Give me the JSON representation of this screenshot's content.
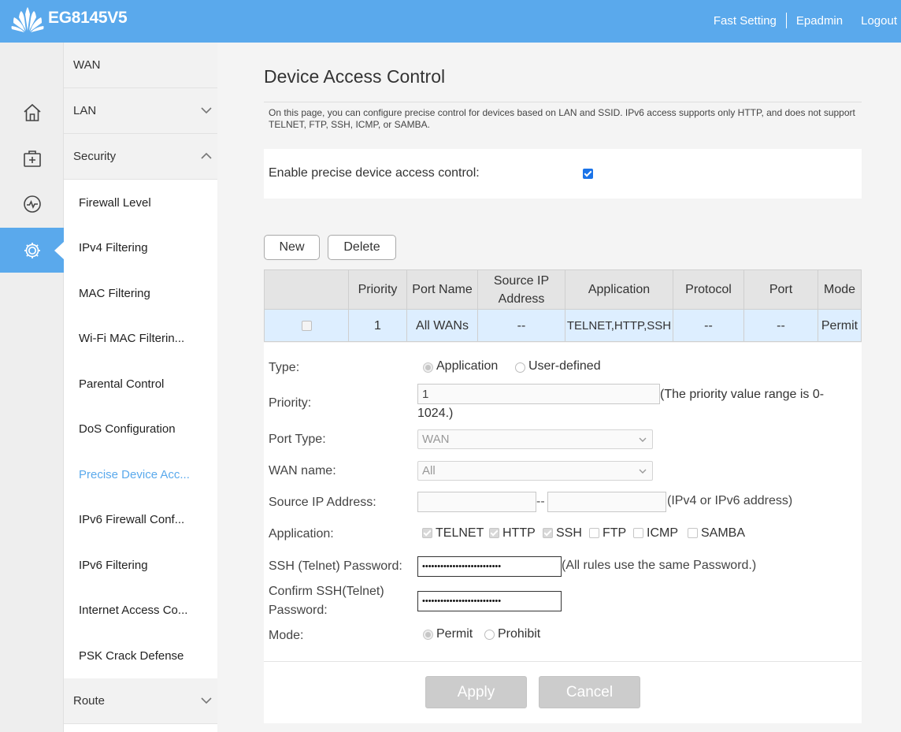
{
  "header": {
    "brand": "EG8145V5",
    "links": [
      "Fast Setting",
      "Epadmin",
      "Logout"
    ]
  },
  "rail": {
    "icons": [
      "home-icon",
      "toolbox-icon",
      "diagnostics-icon",
      "gear-icon"
    ],
    "active_index": 3
  },
  "sidebar": {
    "categories": {
      "wan": "WAN",
      "lan": "LAN",
      "security": "Security",
      "route": "Route"
    },
    "items": [
      {
        "label": "Firewall Level"
      },
      {
        "label": "IPv4 Filtering"
      },
      {
        "label": "MAC Filtering"
      },
      {
        "label": "Wi-Fi MAC Filterin..."
      },
      {
        "label": "Parental Control"
      },
      {
        "label": "DoS Configuration"
      },
      {
        "label": "Precise Device Acc..."
      },
      {
        "label": "IPv6 Firewall Conf..."
      },
      {
        "label": "IPv6 Filtering"
      },
      {
        "label": "Internet Access Co..."
      },
      {
        "label": "PSK Crack Defense"
      }
    ],
    "active_item": "Precise Device Acc..."
  },
  "page": {
    "title": "Device Access Control",
    "description": "On this page, you can configure precise control for devices based on LAN and SSID. IPv6 access supports only HTTP, and does not support TELNET, FTP, SSH, ICMP, or SAMBA.",
    "enable_label": "Enable precise device access control:",
    "enable_checked": true,
    "new_button": "New",
    "delete_button": "Delete"
  },
  "table": {
    "columns": [
      "",
      "Priority",
      "Port Name",
      "Source IP Address",
      "Application",
      "Protocol",
      "Port",
      "Mode"
    ],
    "rows": [
      {
        "checked": false,
        "priority": "1",
        "port_name": "All WANs",
        "source_ip": "--",
        "application": "TELNET,HTTP,SSH",
        "protocol": "--",
        "port": "--",
        "mode": "Permit"
      }
    ]
  },
  "form": {
    "type_label": "Type:",
    "type_options": [
      "Application",
      "User-defined"
    ],
    "type_selected": "Application",
    "priority_label": "Priority:",
    "priority_value": "1",
    "priority_hint": "(The priority value range is 0-1024.)",
    "port_type_label": "Port Type:",
    "port_type_value": "WAN",
    "wan_name_label": "WAN name:",
    "wan_name_value": "All",
    "source_ip_label": "Source IP Address:",
    "source_ip_start": "",
    "source_ip_end": "",
    "source_ip_sep": "--",
    "source_ip_hint": "(IPv4 or IPv6 address)",
    "application_label": "Application:",
    "applications": [
      {
        "name": "TELNET",
        "checked": true
      },
      {
        "name": "HTTP",
        "checked": true
      },
      {
        "name": "SSH",
        "checked": true
      },
      {
        "name": "FTP",
        "checked": false
      },
      {
        "name": "ICMP",
        "checked": false
      },
      {
        "name": "SAMBA",
        "checked": false
      }
    ],
    "ssh_password_label": "SSH (Telnet) Password:",
    "ssh_password_value": "••••••••••••••••••••••••••",
    "ssh_password_hint": "(All rules use the same Password.)",
    "confirm_password_label": "Confirm SSH(Telnet) Password:",
    "confirm_password_value": "••••••••••••••••••••••••••",
    "mode_label": "Mode:",
    "mode_options": [
      "Permit",
      "Prohibit"
    ],
    "mode_selected": "Permit",
    "apply_button": "Apply",
    "cancel_button": "Cancel"
  },
  "colors": {
    "accent": "#5aa9ec",
    "selected_row": "#ddeeff",
    "checkbox_blue": "#1a73e8"
  }
}
